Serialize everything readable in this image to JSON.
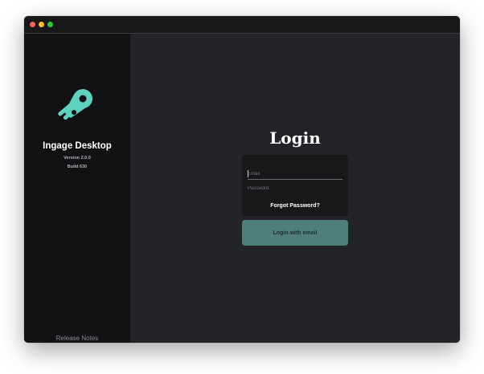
{
  "window": {
    "controls": [
      "close",
      "minimize",
      "maximize"
    ]
  },
  "sidebar": {
    "logo_icon": "rocket-comet-icon",
    "app_name": "Ingage Desktop",
    "version": "Version 2.0.0",
    "build": "Build 630",
    "release_notes": "Release Notes"
  },
  "login": {
    "title": "Login",
    "email_placeholder": "Email",
    "email_value": "",
    "password_placeholder": "Password",
    "password_value": "",
    "forgot_password": "Forgot Password?",
    "submit_label": "Login with email"
  },
  "colors": {
    "accent": "#5ed1bf",
    "button": "#4f7f78",
    "sidebar_bg": "#121214",
    "main_bg": "#232428",
    "card_bg": "#18181a"
  }
}
